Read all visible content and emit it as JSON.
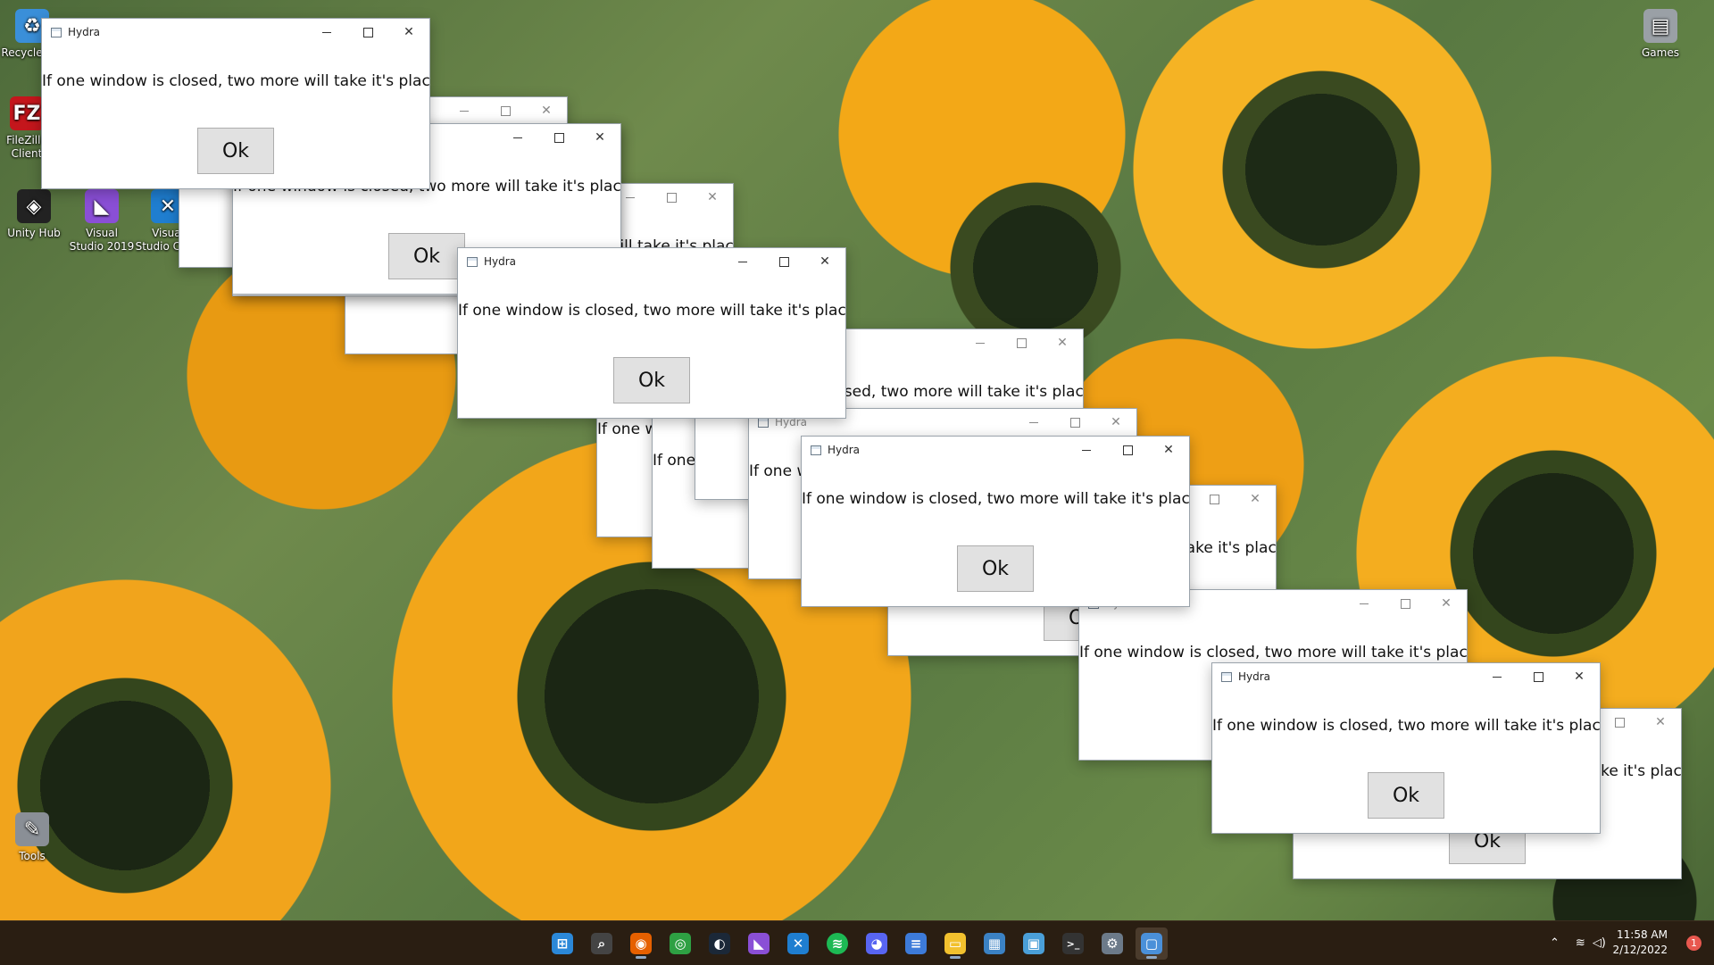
{
  "desktop_icons": [
    {
      "name": "recycle-bin",
      "label": "Recycle Bin",
      "glyph": "♻",
      "color": "#3a8fd9"
    },
    {
      "name": "filezilla",
      "label": "FileZilla Client",
      "glyph": "FZ",
      "color": "#c4161c"
    },
    {
      "name": "unity-hub",
      "label": "Unity Hub",
      "glyph": "◈",
      "color": "#222222"
    },
    {
      "name": "visual-studio-2019",
      "label": "Visual Studio 2019",
      "glyph": "◣",
      "color": "#8a4fd6"
    },
    {
      "name": "visual-studio-code",
      "label": "Visual Studio Code",
      "glyph": "✕",
      "color": "#1f7ed0"
    },
    {
      "name": "tools",
      "label": "Tools",
      "glyph": "✎",
      "color": "#8a8f96"
    },
    {
      "name": "games",
      "label": "Games",
      "glyph": "▤",
      "color": "#9aa0a6"
    }
  ],
  "dialog": {
    "title": "Hydra",
    "message": "If one window is closed, two more will take it's place",
    "ok_label": "Ok"
  },
  "taskbar": {
    "apps": [
      {
        "name": "start",
        "glyph": "⊞",
        "color": "#2b88d8"
      },
      {
        "name": "search",
        "glyph": "⌕",
        "color": "#444444"
      },
      {
        "name": "firefox",
        "glyph": "◉",
        "color": "#e66000"
      },
      {
        "name": "chrome",
        "glyph": "◎",
        "color": "#2ea043"
      },
      {
        "name": "steam",
        "glyph": "◐",
        "color": "#1b2838"
      },
      {
        "name": "visual-studio",
        "glyph": "◣",
        "color": "#8a4fd6"
      },
      {
        "name": "vscode",
        "glyph": "✕",
        "color": "#1f7ed0"
      },
      {
        "name": "spotify",
        "glyph": "≋",
        "color": "#1db954"
      },
      {
        "name": "discord",
        "glyph": "◕",
        "color": "#5865f2"
      },
      {
        "name": "notepad",
        "glyph": "≡",
        "color": "#3d7bd9"
      },
      {
        "name": "file-explorer",
        "glyph": "▭",
        "color": "#f2c12e"
      },
      {
        "name": "store",
        "glyph": "▦",
        "color": "#3b82c4"
      },
      {
        "name": "control-panel",
        "glyph": "▣",
        "color": "#4a9fd8"
      },
      {
        "name": "terminal",
        "glyph": ">_",
        "color": "#333333"
      },
      {
        "name": "settings",
        "glyph": "⚙",
        "color": "#6c7a89"
      },
      {
        "name": "hydra",
        "glyph": "▢",
        "color": "#4a90d9"
      }
    ],
    "time": "11:58 AM",
    "date": "2/12/2022",
    "notification_count": "1"
  }
}
